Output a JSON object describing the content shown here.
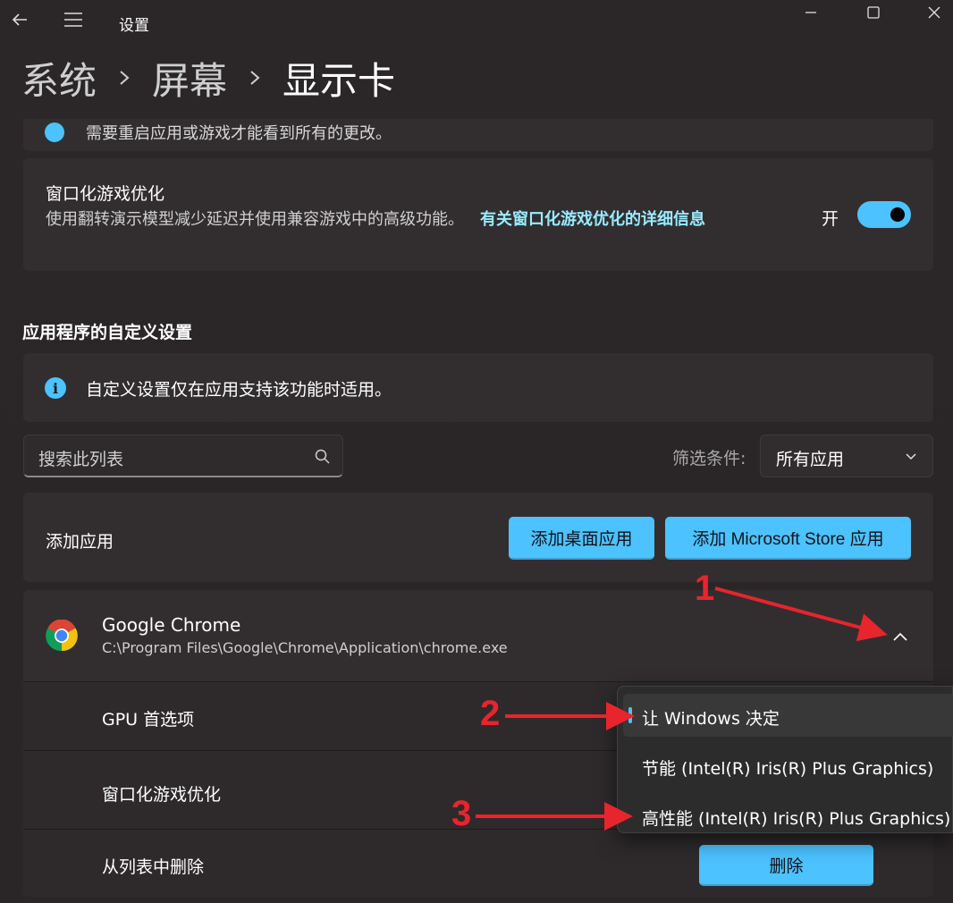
{
  "window": {
    "app_title": "设置"
  },
  "breadcrumb": {
    "items": [
      "系统",
      "屏幕",
      "显示卡"
    ]
  },
  "partial_notice": {
    "text": "需要重启应用或游戏才能看到所有的更改。"
  },
  "windowed_game_opt": {
    "title": "窗口化游戏优化",
    "description": "使用翻转演示模型减少延迟并使用兼容游戏中的高级功能。",
    "link": "有关窗口化游戏优化的详细信息",
    "state_label": "开",
    "enabled": true
  },
  "app_custom": {
    "heading": "应用程序的自定义设置",
    "info_text": "自定义设置仅在应用支持该功能时适用。",
    "search_placeholder": "搜索此列表",
    "filter_label": "筛选条件:",
    "filter_value": "所有应用",
    "add_label": "添加应用",
    "add_desktop_button": "添加桌面应用",
    "add_store_button": "添加 Microsoft Store 应用"
  },
  "app_entry": {
    "name": "Google Chrome",
    "path": "C:\\Program Files\\Google\\Chrome\\Application\\chrome.exe",
    "gpu_label": "GPU 首选项",
    "wgo_label": "窗口化游戏优化",
    "remove_label": "从列表中删除",
    "delete_button": "删除"
  },
  "gpu_options": [
    "让 Windows 决定",
    "节能 (Intel(R) Iris(R) Plus Graphics)",
    "高性能 (Intel(R) Iris(R) Plus Graphics)"
  ],
  "gpu_selected_index": 0,
  "annotations": [
    "1",
    "2",
    "3"
  ],
  "colors": {
    "accent": "#4cc2ff",
    "link": "#99ebff",
    "annotation": "#e8242c",
    "card": "#322e30"
  }
}
